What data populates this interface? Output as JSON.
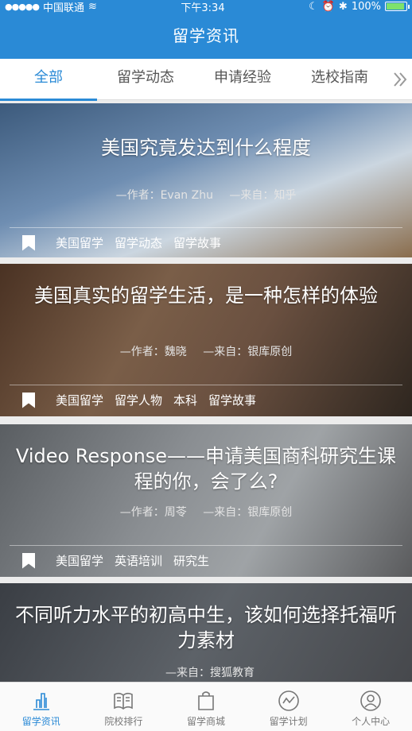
{
  "status_bar": {
    "carrier": "中国联通",
    "time": "下午3:34",
    "battery": "100%"
  },
  "header": {
    "title": "留学资讯"
  },
  "tabs": [
    {
      "label": "全部"
    },
    {
      "label": "留学动态"
    },
    {
      "label": "申请经验"
    },
    {
      "label": "选校指南"
    }
  ],
  "articles": [
    {
      "title": "美国究竟发达到什么程度",
      "author": "—作者：Evan Zhu",
      "source": "—来自：知乎",
      "tags": [
        "美国留学",
        "留学动态",
        "留学故事"
      ]
    },
    {
      "title": "美国真实的留学生活，是一种怎样的体验",
      "author": "—作者：魏晓",
      "source": "—来自：银库原创",
      "tags": [
        "美国留学",
        "留学人物",
        "本科",
        "留学故事"
      ]
    },
    {
      "title": "Video Response——申请美国商科研究生课程的你，会了么?",
      "author": "—作者：周苓",
      "source": "—来自：银库原创",
      "tags": [
        "美国留学",
        "英语培训",
        "研究生"
      ]
    },
    {
      "title": "不同听力水平的初高中生，该如何选择托福听力素材",
      "source": "—来自：搜狐教育"
    }
  ],
  "tabbar": [
    {
      "label": "留学资讯",
      "icon": "chart-icon"
    },
    {
      "label": "院校排行",
      "icon": "book-icon"
    },
    {
      "label": "留学商城",
      "icon": "bag-icon"
    },
    {
      "label": "留学计划",
      "icon": "trend-icon"
    },
    {
      "label": "个人中心",
      "icon": "person-icon"
    }
  ],
  "colors": {
    "accent": "#2a8ad6"
  }
}
